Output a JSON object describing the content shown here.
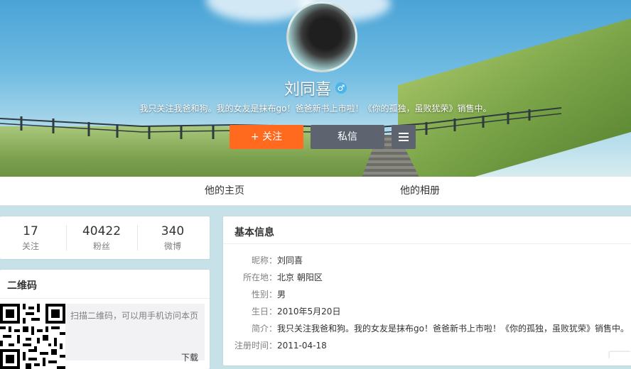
{
  "profile": {
    "name": "刘同喜",
    "gender_symbol": "♂",
    "bio": "我只关注我爸和狗。我的女友是抹布go！爸爸新书上市啦！《你的孤独，虽败犹荣》销售中。",
    "follow_label": "+ 关注",
    "message_label": "私信"
  },
  "tabs": {
    "home": "他的主页",
    "album": "他的相册"
  },
  "stats": [
    {
      "count": "17",
      "label": "关注"
    },
    {
      "count": "40422",
      "label": "粉丝"
    },
    {
      "count": "340",
      "label": "微博"
    }
  ],
  "qr": {
    "title": "二维码",
    "hint": "扫描二维码，可以用手机访问本页",
    "download": "下载"
  },
  "info": {
    "title": "基本信息",
    "rows": [
      {
        "key": "昵称：",
        "value": "刘同喜"
      },
      {
        "key": "所在地：",
        "value": "北京 朝阳区"
      },
      {
        "key": "性别：",
        "value": "男"
      },
      {
        "key": "生日：",
        "value": "2010年5月20日"
      },
      {
        "key": "简介：",
        "value": "我只关注我爸和狗。我的女友是抹布go！爸爸新书上市啦！《你的孤独，虽败犹荣》销售中。"
      },
      {
        "key": "注册时间：",
        "value": "2011-04-18"
      }
    ]
  },
  "colors": {
    "follow_button": "#ff6a1f",
    "message_button": "#5d6470",
    "page_bg": "#c7e1e8",
    "gender_badge": "#4db4e9"
  }
}
